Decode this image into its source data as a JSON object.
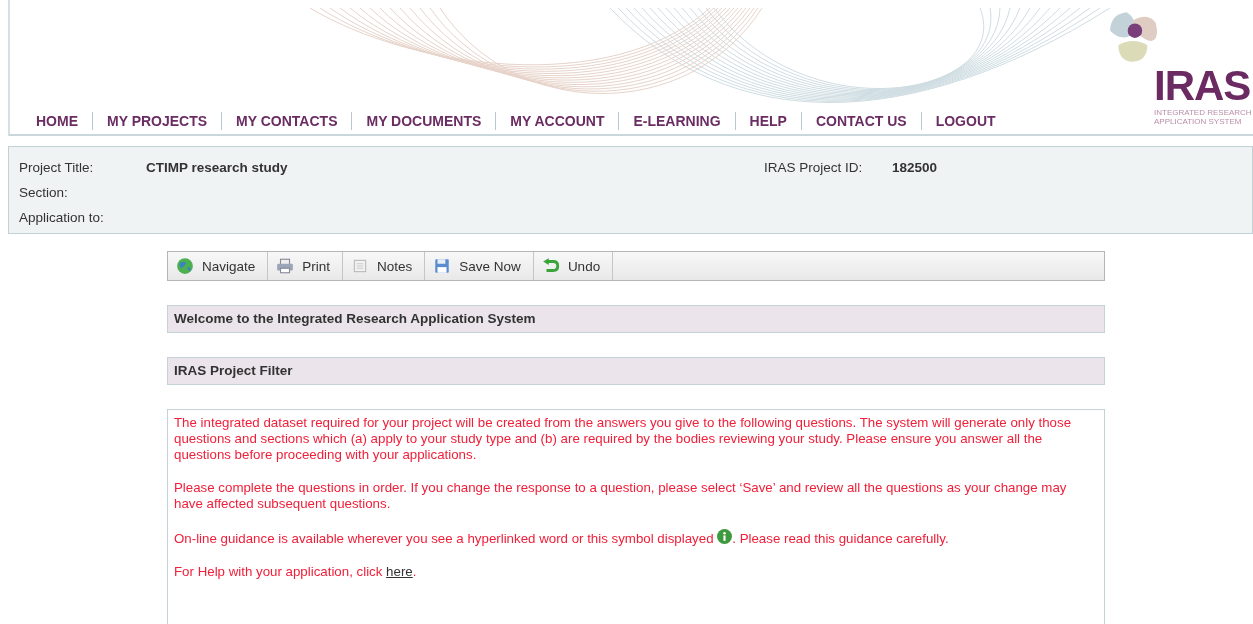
{
  "logo": {
    "name": "IRAS",
    "subtitle_lines": [
      "INTEGRATED RESEARCH",
      "APPLICATION SYSTEM"
    ]
  },
  "nav": [
    {
      "label": "HOME"
    },
    {
      "label": "MY PROJECTS"
    },
    {
      "label": "MY CONTACTS"
    },
    {
      "label": "MY DOCUMENTS"
    },
    {
      "label": "MY ACCOUNT"
    },
    {
      "label": "E-LEARNING"
    },
    {
      "label": "HELP"
    },
    {
      "label": "CONTACT US"
    },
    {
      "label": "LOGOUT"
    }
  ],
  "project": {
    "title_label": "Project Title:",
    "title_value": "CTIMP research study",
    "section_label": "Section:",
    "application_label": "Application to:",
    "id_label": "IRAS Project ID:",
    "id_value": "182500"
  },
  "toolbar": [
    {
      "label": "Navigate",
      "kind": "globe"
    },
    {
      "label": "Print",
      "kind": "printer"
    },
    {
      "label": "Notes",
      "kind": "note"
    },
    {
      "label": "Save Now",
      "kind": "save"
    },
    {
      "label": "Undo",
      "kind": "undo"
    }
  ],
  "panels": [
    {
      "title": "Welcome to the Integrated Research Application System"
    },
    {
      "title": "IRAS Project Filter"
    }
  ],
  "paragraphs": [
    {
      "kind": "plain",
      "text": "The integrated dataset required for your project will be created from the answers you give to the following questions. The system will generate only those questions and sections which (a) apply to your study type and (b) are required by the bodies reviewing your study. Please ensure you answer all the questions before proceeding with your applications."
    },
    {
      "kind": "plain",
      "text": "Please complete the questions in order. If you change the response to a question, please select ‘Save’ and review all the questions as your change may have affected subsequent questions."
    },
    {
      "kind": "icon",
      "text": "On-line guidance is available wherever you see a hyperlinked word or this symbol displayed",
      "after": ". Please read this guidance carefully."
    },
    {
      "kind": "link",
      "text": "For Help with your application, click",
      "link": "here",
      "after": "."
    }
  ]
}
